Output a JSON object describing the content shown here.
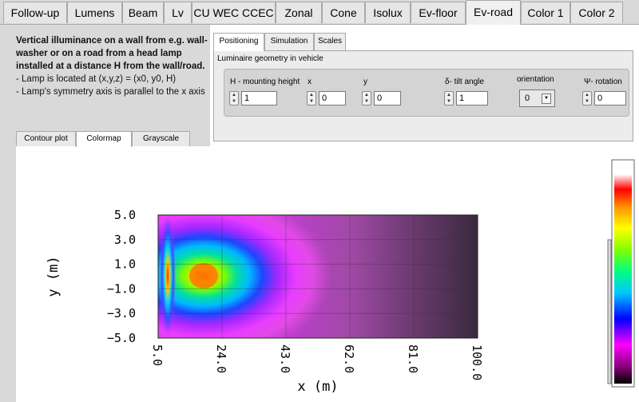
{
  "tabs": [
    "Follow-up",
    "Lumens",
    "Beam",
    "Lv",
    "CU WEC CCEC",
    "Zonal",
    "Cone",
    "Isolux",
    "Ev-floor",
    "Ev-road",
    "Color 1",
    "Color 2"
  ],
  "active_tab": "Ev-road",
  "description": {
    "heading": "Vertical illuminance on a wall from e.g. wall-washer or on a road from a head lamp installed at a distance H from the wall/road.",
    "line1": "- Lamp is located at (x,y,z) = (x0, y0, H)",
    "line2": "- Lamp's symmetry axis is parallel to the x axis"
  },
  "panel_tabs": [
    "Positioning",
    "Simulation",
    "Scales"
  ],
  "active_panel_tab": "Positioning",
  "geometry_label": "Luminaire geometry in vehicle",
  "fields": {
    "h_label": "H - mounting height",
    "h_value": "1",
    "x_label": "x",
    "x_value": "0",
    "y_label": "y",
    "y_value": "0",
    "tilt_label": "δ- tilt angle",
    "tilt_value": "1",
    "orient_label": "orientation",
    "orient_value": "0",
    "rot_label": "Ψ- rotation",
    "rot_value": "0"
  },
  "plot_tabs": [
    "Contour plot",
    "Colormap",
    "Grayscale"
  ],
  "active_plot_tab": "Colormap",
  "chart_data": {
    "type": "heatmap",
    "xlabel": "x (m)",
    "ylabel": "y (m)",
    "x_ticks": [
      "5.0",
      "24.0",
      "43.0",
      "62.0",
      "81.0",
      "100.0"
    ],
    "y_ticks": [
      "5.0",
      "3.0",
      "1.0",
      "−1.0",
      "−3.0",
      "−5.0"
    ],
    "xlim": [
      5,
      100
    ],
    "ylim": [
      -5,
      5
    ],
    "grid": true,
    "colorscale": [
      "#ffffff",
      "#ff0000",
      "#ffb000",
      "#ffff00",
      "#00ff00",
      "#00c8ff",
      "#0000ff",
      "#ff00ff",
      "#000000"
    ]
  }
}
